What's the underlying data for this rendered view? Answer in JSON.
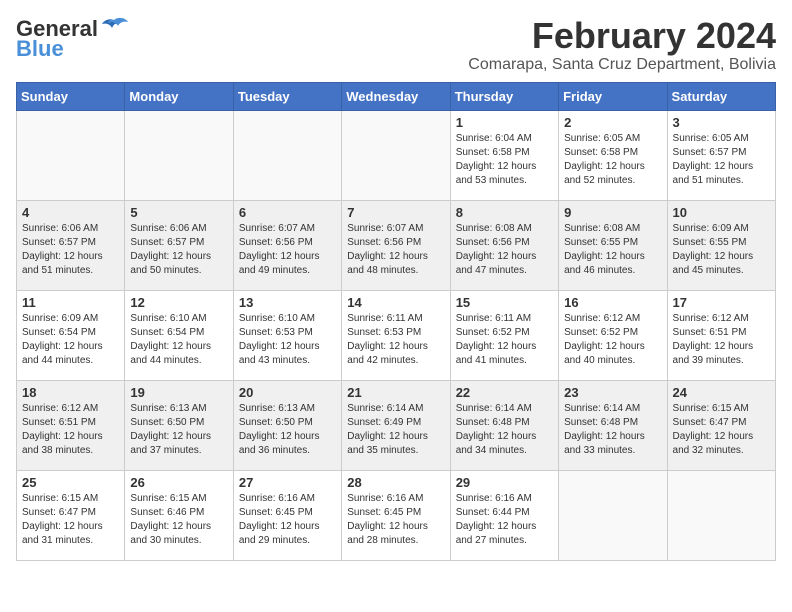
{
  "header": {
    "logo_line1": "General",
    "logo_line2": "Blue",
    "title": "February 2024",
    "subtitle": "Comarapa, Santa Cruz Department, Bolivia"
  },
  "weekdays": [
    "Sunday",
    "Monday",
    "Tuesday",
    "Wednesday",
    "Thursday",
    "Friday",
    "Saturday"
  ],
  "weeks": [
    [
      {
        "day": "",
        "info": ""
      },
      {
        "day": "",
        "info": ""
      },
      {
        "day": "",
        "info": ""
      },
      {
        "day": "",
        "info": ""
      },
      {
        "day": "1",
        "info": "Sunrise: 6:04 AM\nSunset: 6:58 PM\nDaylight: 12 hours\nand 53 minutes."
      },
      {
        "day": "2",
        "info": "Sunrise: 6:05 AM\nSunset: 6:58 PM\nDaylight: 12 hours\nand 52 minutes."
      },
      {
        "day": "3",
        "info": "Sunrise: 6:05 AM\nSunset: 6:57 PM\nDaylight: 12 hours\nand 51 minutes."
      }
    ],
    [
      {
        "day": "4",
        "info": "Sunrise: 6:06 AM\nSunset: 6:57 PM\nDaylight: 12 hours\nand 51 minutes."
      },
      {
        "day": "5",
        "info": "Sunrise: 6:06 AM\nSunset: 6:57 PM\nDaylight: 12 hours\nand 50 minutes."
      },
      {
        "day": "6",
        "info": "Sunrise: 6:07 AM\nSunset: 6:56 PM\nDaylight: 12 hours\nand 49 minutes."
      },
      {
        "day": "7",
        "info": "Sunrise: 6:07 AM\nSunset: 6:56 PM\nDaylight: 12 hours\nand 48 minutes."
      },
      {
        "day": "8",
        "info": "Sunrise: 6:08 AM\nSunset: 6:56 PM\nDaylight: 12 hours\nand 47 minutes."
      },
      {
        "day": "9",
        "info": "Sunrise: 6:08 AM\nSunset: 6:55 PM\nDaylight: 12 hours\nand 46 minutes."
      },
      {
        "day": "10",
        "info": "Sunrise: 6:09 AM\nSunset: 6:55 PM\nDaylight: 12 hours\nand 45 minutes."
      }
    ],
    [
      {
        "day": "11",
        "info": "Sunrise: 6:09 AM\nSunset: 6:54 PM\nDaylight: 12 hours\nand 44 minutes."
      },
      {
        "day": "12",
        "info": "Sunrise: 6:10 AM\nSunset: 6:54 PM\nDaylight: 12 hours\nand 44 minutes."
      },
      {
        "day": "13",
        "info": "Sunrise: 6:10 AM\nSunset: 6:53 PM\nDaylight: 12 hours\nand 43 minutes."
      },
      {
        "day": "14",
        "info": "Sunrise: 6:11 AM\nSunset: 6:53 PM\nDaylight: 12 hours\nand 42 minutes."
      },
      {
        "day": "15",
        "info": "Sunrise: 6:11 AM\nSunset: 6:52 PM\nDaylight: 12 hours\nand 41 minutes."
      },
      {
        "day": "16",
        "info": "Sunrise: 6:12 AM\nSunset: 6:52 PM\nDaylight: 12 hours\nand 40 minutes."
      },
      {
        "day": "17",
        "info": "Sunrise: 6:12 AM\nSunset: 6:51 PM\nDaylight: 12 hours\nand 39 minutes."
      }
    ],
    [
      {
        "day": "18",
        "info": "Sunrise: 6:12 AM\nSunset: 6:51 PM\nDaylight: 12 hours\nand 38 minutes."
      },
      {
        "day": "19",
        "info": "Sunrise: 6:13 AM\nSunset: 6:50 PM\nDaylight: 12 hours\nand 37 minutes."
      },
      {
        "day": "20",
        "info": "Sunrise: 6:13 AM\nSunset: 6:50 PM\nDaylight: 12 hours\nand 36 minutes."
      },
      {
        "day": "21",
        "info": "Sunrise: 6:14 AM\nSunset: 6:49 PM\nDaylight: 12 hours\nand 35 minutes."
      },
      {
        "day": "22",
        "info": "Sunrise: 6:14 AM\nSunset: 6:48 PM\nDaylight: 12 hours\nand 34 minutes."
      },
      {
        "day": "23",
        "info": "Sunrise: 6:14 AM\nSunset: 6:48 PM\nDaylight: 12 hours\nand 33 minutes."
      },
      {
        "day": "24",
        "info": "Sunrise: 6:15 AM\nSunset: 6:47 PM\nDaylight: 12 hours\nand 32 minutes."
      }
    ],
    [
      {
        "day": "25",
        "info": "Sunrise: 6:15 AM\nSunset: 6:47 PM\nDaylight: 12 hours\nand 31 minutes."
      },
      {
        "day": "26",
        "info": "Sunrise: 6:15 AM\nSunset: 6:46 PM\nDaylight: 12 hours\nand 30 minutes."
      },
      {
        "day": "27",
        "info": "Sunrise: 6:16 AM\nSunset: 6:45 PM\nDaylight: 12 hours\nand 29 minutes."
      },
      {
        "day": "28",
        "info": "Sunrise: 6:16 AM\nSunset: 6:45 PM\nDaylight: 12 hours\nand 28 minutes."
      },
      {
        "day": "29",
        "info": "Sunrise: 6:16 AM\nSunset: 6:44 PM\nDaylight: 12 hours\nand 27 minutes."
      },
      {
        "day": "",
        "info": ""
      },
      {
        "day": "",
        "info": ""
      }
    ]
  ]
}
